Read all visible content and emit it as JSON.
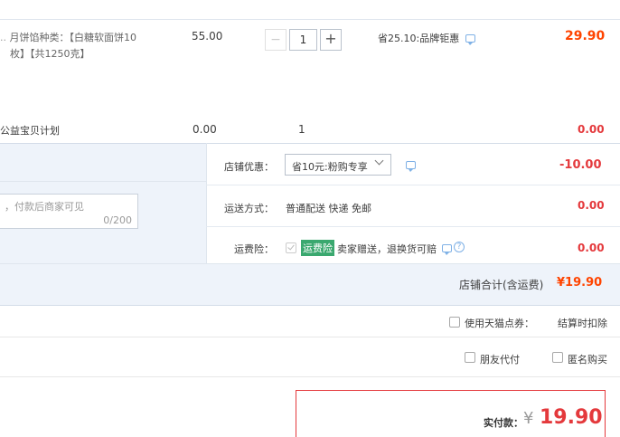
{
  "item": {
    "spec_line1": "月饼馅种类：【白糖软面饼10",
    "spec_line2": "枚】【共1250克】",
    "unit_price": "55.00",
    "quantity": "1",
    "qty_minus": "−",
    "qty_plus": "+",
    "discount_label": "省25.10:品牌钜惠",
    "total": "29.90"
  },
  "charity": {
    "name": "公益宝贝计划",
    "price": "0.00",
    "quantity": "1",
    "total": "0.00"
  },
  "shop_discount": {
    "label": "店铺优惠：",
    "selected": "省10元:粉购专享",
    "amount": "-10.00"
  },
  "message_box": {
    "placeholder": "，付款后商家可见",
    "counter": "0/200"
  },
  "shipping": {
    "label": "运送方式：",
    "value": "普通配送 快递 免邮",
    "amount": "0.00"
  },
  "insurance": {
    "label": "运费险：",
    "badge": "运费险",
    "desc": "卖家赠送，退换货可赔",
    "amount": "0.00"
  },
  "shop_total": {
    "label": "店铺合计(含运费)",
    "amount": "¥19.90"
  },
  "tmall_points": {
    "label": "使用天猫点券：",
    "note": "结算时扣除"
  },
  "options": {
    "friend_pay": "朋友代付",
    "anonymous": "匿名购买"
  },
  "payment": {
    "label": "实付款：",
    "currency": "¥",
    "amount": "19.90"
  },
  "colors": {
    "orange_red": "#ff4400",
    "crimson": "#e4393c",
    "panel_blue": "#eef3fa",
    "border": "#dfe6ee",
    "badge_green": "#3aa86f"
  },
  "icons": [
    "message-icon",
    "question-icon",
    "checkbox-icon",
    "chevron-down-icon"
  ]
}
